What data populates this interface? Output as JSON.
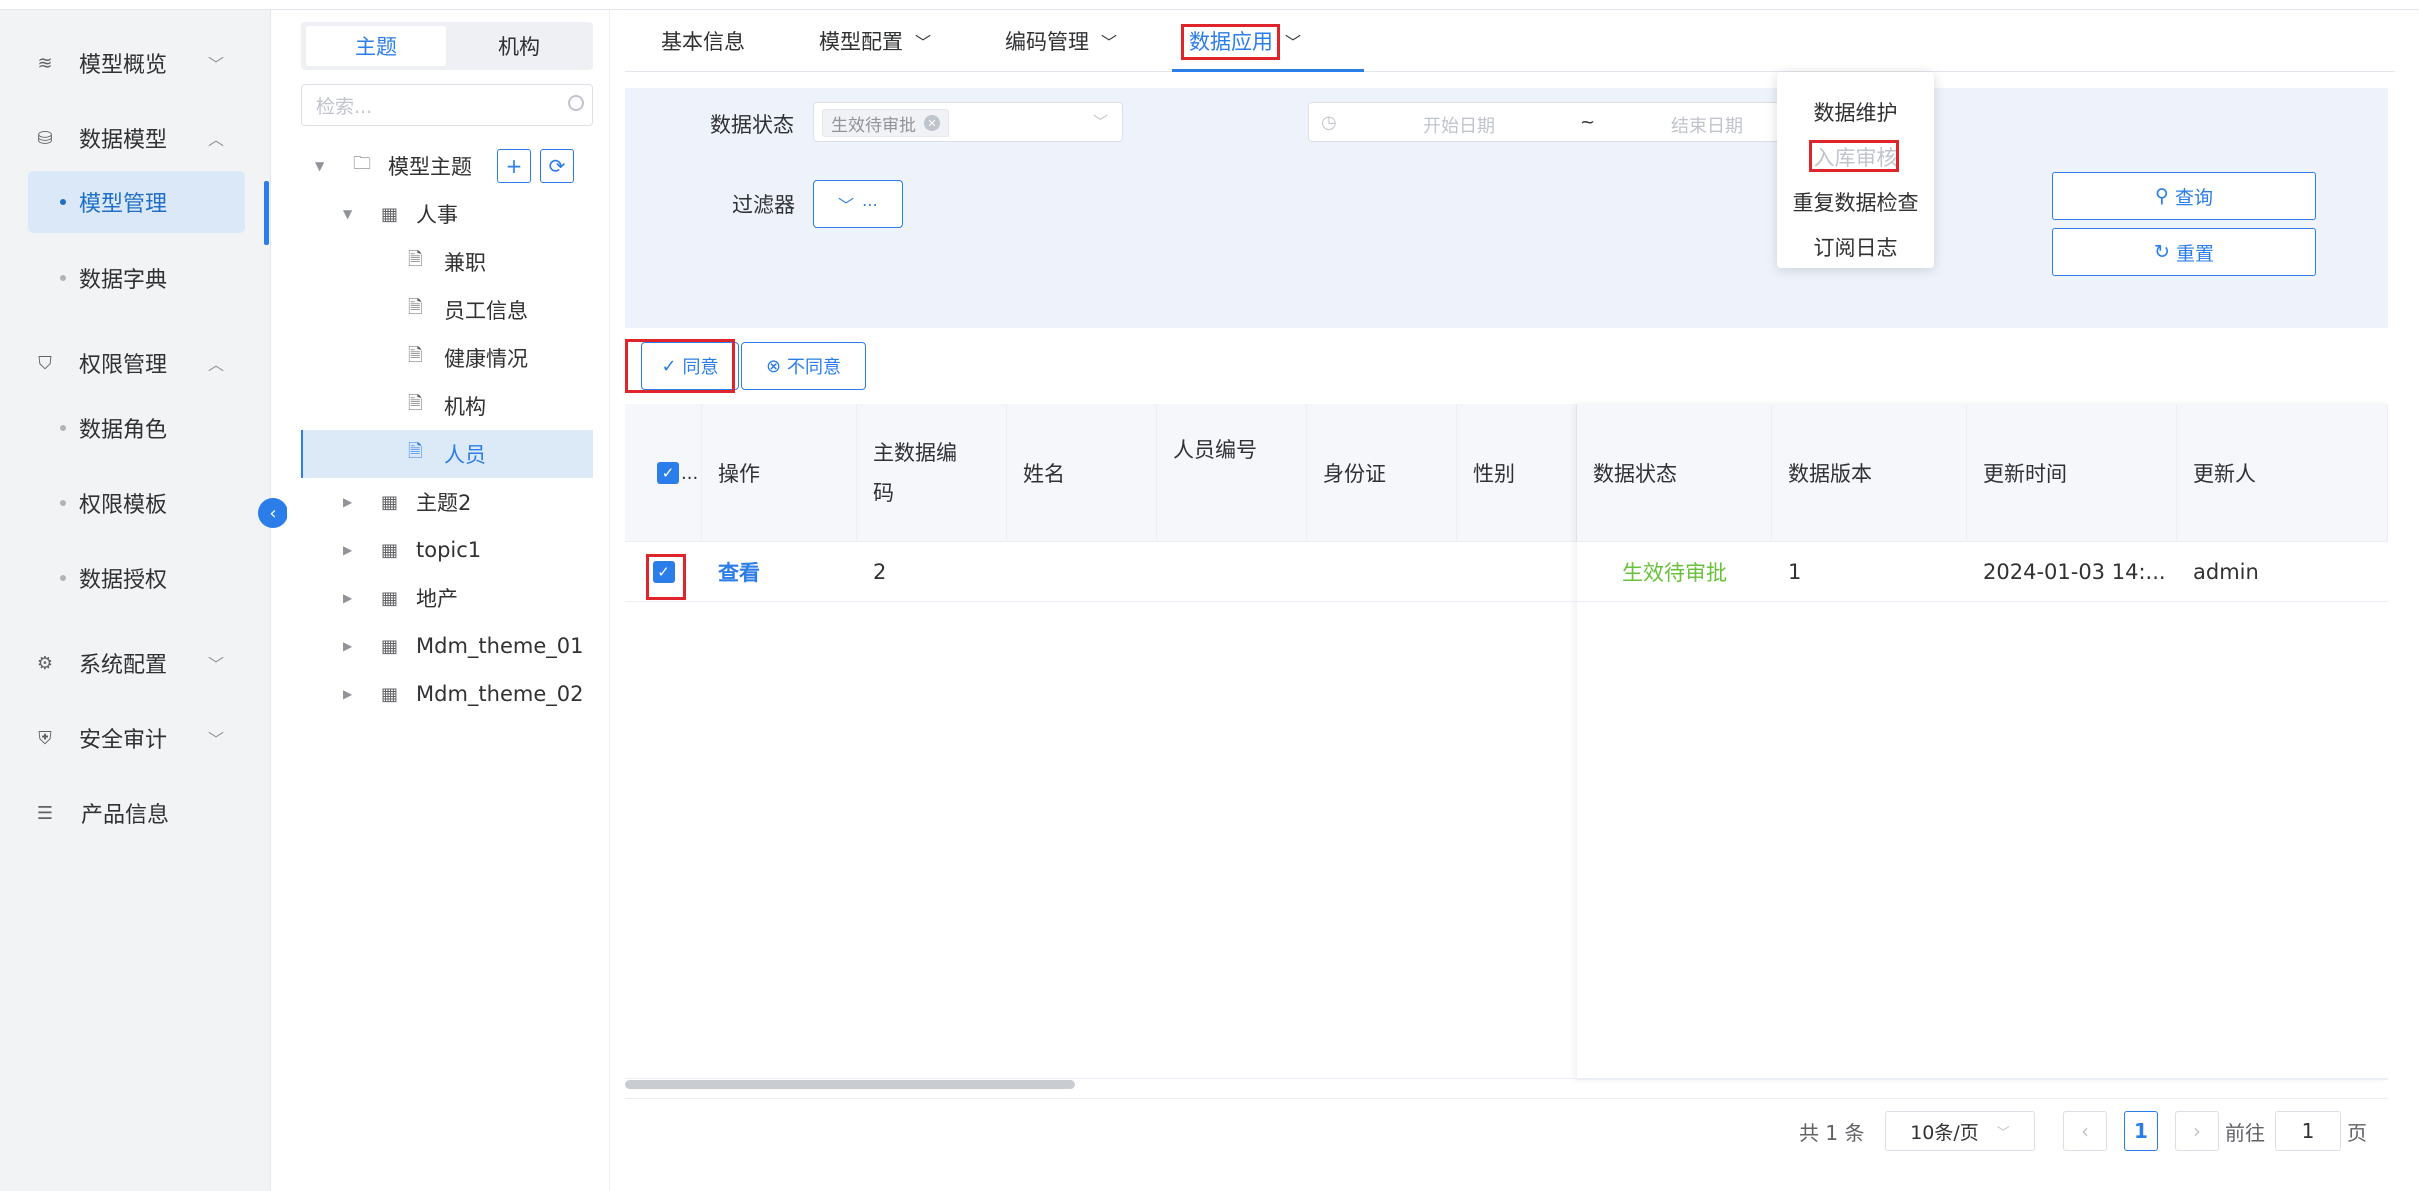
{
  "sidebar": {
    "items": [
      {
        "label": "模型概览",
        "icon": "layers-icon",
        "expanded": false
      },
      {
        "label": "数据模型",
        "icon": "database-icon",
        "expanded": true,
        "children": [
          {
            "label": "模型管理",
            "active": true
          },
          {
            "label": "数据字典"
          }
        ]
      },
      {
        "label": "权限管理",
        "icon": "shield-icon",
        "expanded": true,
        "children": [
          {
            "label": "数据角色"
          },
          {
            "label": "权限模板"
          },
          {
            "label": "数据授权"
          }
        ]
      },
      {
        "label": "系统配置",
        "icon": "chip-icon",
        "expanded": false
      },
      {
        "label": "安全审计",
        "icon": "audit-shield-icon",
        "expanded": false
      },
      {
        "label": "产品信息",
        "icon": "document-list-icon"
      }
    ]
  },
  "tree": {
    "tabs": [
      "主题",
      "机构"
    ],
    "active_tab": "主题",
    "search_placeholder": "检索...",
    "root": "模型主题",
    "nodes": [
      "人事",
      "兼职",
      "员工信息",
      "健康情况",
      "机构",
      "人员",
      "主题2",
      "topic1",
      "地产",
      "Mdm_theme_01",
      "Mdm_theme_02"
    ],
    "selected": "人员"
  },
  "tabs": {
    "basic": "基本信息",
    "model_config": "模型配置",
    "code_mgmt": "编码管理",
    "data_app": "数据应用"
  },
  "dropdown_menu": {
    "items": [
      "数据维护",
      "入库审核",
      "重复数据检查",
      "订阅日志"
    ],
    "disabled_item": "入库审核"
  },
  "filters": {
    "status_label": "数据状态",
    "status_tag": "生效待审批",
    "filter_label": "过滤器",
    "filter_btn": "⋯",
    "start_placeholder": "开始日期",
    "range_sep": "~",
    "end_placeholder": "结束日期",
    "query_btn": "查询",
    "reset_btn": "重置"
  },
  "actions": {
    "approve": "同意",
    "reject": "不同意"
  },
  "table": {
    "columns": [
      "操作",
      "主数据编码",
      "姓名",
      "人员编号",
      "身份证",
      "性别",
      "数据状态",
      "数据版本",
      "更新时间",
      "更新人"
    ],
    "select_all_label": "...",
    "rows": [
      {
        "action": "查看",
        "code": "2",
        "name": "",
        "emp_no": "",
        "id_card": "",
        "gender": "",
        "status": "生效待审批",
        "version": "1",
        "updated": "2024-01-03 14:...",
        "updater": "admin",
        "checked": true
      }
    ]
  },
  "pagination": {
    "total_text": "共 1 条",
    "page_size": "10条/页",
    "current_page": "1",
    "goto_prefix": "前往",
    "goto_value": "1",
    "goto_suffix": "页"
  },
  "colors": {
    "accent": "#2b7de9",
    "highlight": "#e0242b",
    "status_green": "#67c23a"
  }
}
